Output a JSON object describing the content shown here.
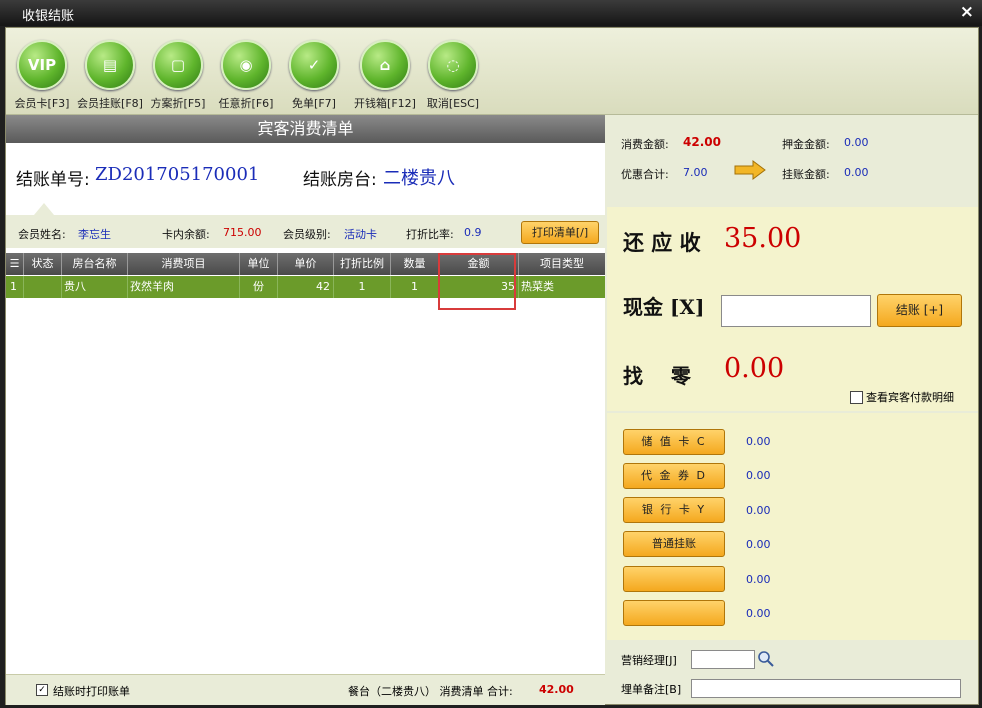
{
  "window": {
    "title": "收银结账",
    "close": "×"
  },
  "toolbar": [
    {
      "label": "会员卡[F3]",
      "glyph": "VIP"
    },
    {
      "label": "会员挂账[F8]",
      "glyph": "▤"
    },
    {
      "label": "方案折[F5]",
      "glyph": "▢"
    },
    {
      "label": "任意折[F6]",
      "glyph": "◉"
    },
    {
      "label": "免单[F7]",
      "glyph": "✓"
    },
    {
      "label": "开钱箱[F12]",
      "glyph": "⌂"
    },
    {
      "label": "取消[ESC]",
      "glyph": "◌"
    }
  ],
  "left": {
    "header": "宾客消费清单",
    "bill_no_label": "结账单号:",
    "bill_no": "ZD201705170001",
    "table_label": "结账房台:",
    "table": "二楼贵八",
    "member": {
      "name_label": "会员姓名:",
      "name": "李忘生",
      "balance_label": "卡内余额:",
      "balance": "715.00",
      "level_label": "会员级别:",
      "level": "活动卡",
      "discount_label": "打折比率:",
      "discount": "0.9",
      "print_button": "打印清单[/]"
    },
    "columns": [
      "☰",
      "状态",
      "房台名称",
      "消费项目",
      "单位",
      "单价",
      "打折比例",
      "数量",
      "金额",
      "项目类型"
    ],
    "rows": [
      [
        "1",
        "",
        "贵八",
        "孜然羊肉",
        "份",
        "42",
        "1",
        "1",
        "35",
        "热菜类"
      ]
    ],
    "footer": {
      "print_on_checkout": "结账时打印账单",
      "summary": "餐台（二楼贵八） 消费清单 合计:",
      "total": "42.00"
    }
  },
  "right": {
    "consume_label": "消费金额:",
    "consume": "42.00",
    "deposit_label": "押金金额:",
    "deposit": "0.00",
    "discount_total_label": "优惠合计:",
    "discount_total": "7.00",
    "credit_label": "挂账金额:",
    "credit": "0.00",
    "due_label": "还 应 收",
    "due": "35.00",
    "cash_label": "现金 [X]",
    "cash_value": "",
    "checkout_button": "结账 [+]",
    "change_label": "找    零",
    "change": "0.00",
    "view_detail": "查看宾客付款明细",
    "payments": [
      {
        "label": "储 值 卡 C",
        "value": "0.00"
      },
      {
        "label": "代 金 券 D",
        "value": "0.00"
      },
      {
        "label": "银 行 卡 Y",
        "value": "0.00"
      },
      {
        "label": "普通挂账",
        "value": "0.00"
      },
      {
        "label": "",
        "value": "0.00"
      },
      {
        "label": "",
        "value": "0.00"
      }
    ],
    "manager_label": "营销经理[J]",
    "manager_value": "",
    "remark_label": "埋单备注[B]",
    "remark_value": ""
  },
  "colors": {
    "accent_green": "#6b9b2a",
    "orange": "#f4a81e",
    "red": "#cc0000",
    "blue": "#1a2cb8"
  }
}
